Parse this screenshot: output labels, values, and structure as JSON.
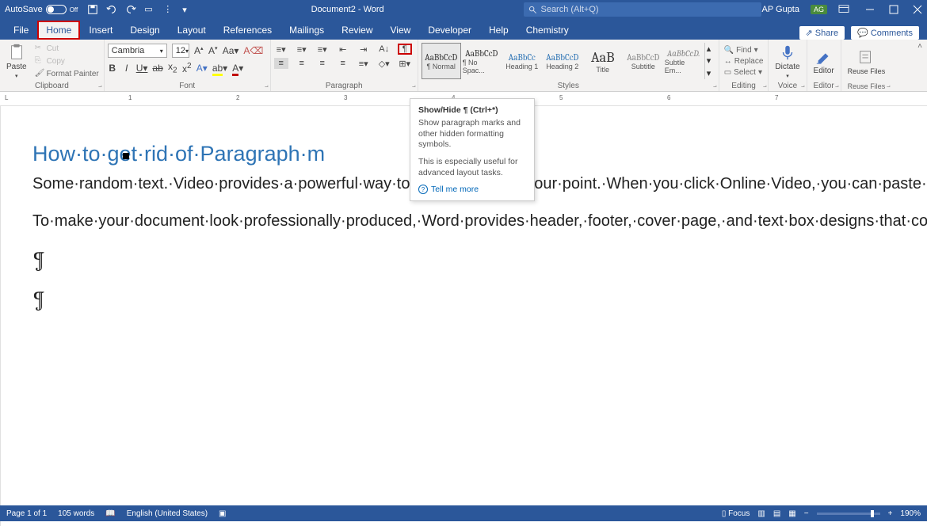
{
  "title_bar": {
    "autosave_label": "AutoSave",
    "autosave_off": "Off",
    "doc_title": "Document2 - Word",
    "search_placeholder": "Search (Alt+Q)",
    "user_name": "AP Gupta",
    "user_initials": "AG"
  },
  "tabs": [
    "File",
    "Home",
    "Insert",
    "Design",
    "Layout",
    "References",
    "Mailings",
    "Review",
    "View",
    "Developer",
    "Help",
    "Chemistry"
  ],
  "tab_right": {
    "share": "Share",
    "comments": "Comments"
  },
  "clipboard": {
    "paste": "Paste",
    "cut": "Cut",
    "copy": "Copy",
    "format_painter": "Format Painter",
    "label": "Clipboard"
  },
  "font": {
    "face": "Cambria",
    "size": "12",
    "label": "Font"
  },
  "paragraph": {
    "label": "Paragraph"
  },
  "styles": {
    "label": "Styles",
    "items": [
      {
        "preview": "AaBbCcD",
        "name": "¶ Normal"
      },
      {
        "preview": "AaBbCcD",
        "name": "¶ No Spac..."
      },
      {
        "preview": "AaBbCc",
        "name": "Heading 1"
      },
      {
        "preview": "AaBbCcD",
        "name": "Heading 2"
      },
      {
        "preview": "AaB",
        "name": "Title"
      },
      {
        "preview": "AaBbCcD",
        "name": "Subtitle"
      },
      {
        "preview": "AaBbCcD.",
        "name": "Subtle Em..."
      }
    ]
  },
  "editing": {
    "label": "Editing",
    "find": "Find",
    "replace": "Replace",
    "select": "Select"
  },
  "voice": {
    "label": "Voice",
    "dictate": "Dictate"
  },
  "editor": {
    "label": "Editor",
    "btn": "Editor"
  },
  "reuse": {
    "label": "Reuse Files",
    "btn": "Reuse Files"
  },
  "tooltip": {
    "title": "Show/Hide ¶ (Ctrl+*)",
    "p1": "Show paragraph marks and other hidden formatting symbols.",
    "p2": "This is especially useful for advanced layout tasks.",
    "link": "Tell me more"
  },
  "document": {
    "title": "How·to·get·rid·of·Paragraph·m",
    "p1": "Some·random·text.·Video·provides·a·powerful·way·to·help·you·prove·your·point.·When·you·click·Online·Video,·you·can·paste·in·the·embed·code·for·the·video·you·want·to·add.·You·can·also·type·a·keyword·to·search·online·for·the·video·that·best·fits·your·document.¶",
    "p2": "To·make·your·document·look·professionally·produced,·Word·provides·header,·footer,·cover·page,·and·text·box·designs·that·complement·each·other.·For·example,·you·can·add·a·matching·cover·page,·header,·and·sidebar.·Click·Insert·and·then·choose·the·elements·you·want·from·the·different·galleries.¶"
  },
  "status": {
    "page": "Page 1 of 1",
    "words": "105 words",
    "lang": "English (United States)",
    "focus": "Focus",
    "zoom": "190%"
  }
}
